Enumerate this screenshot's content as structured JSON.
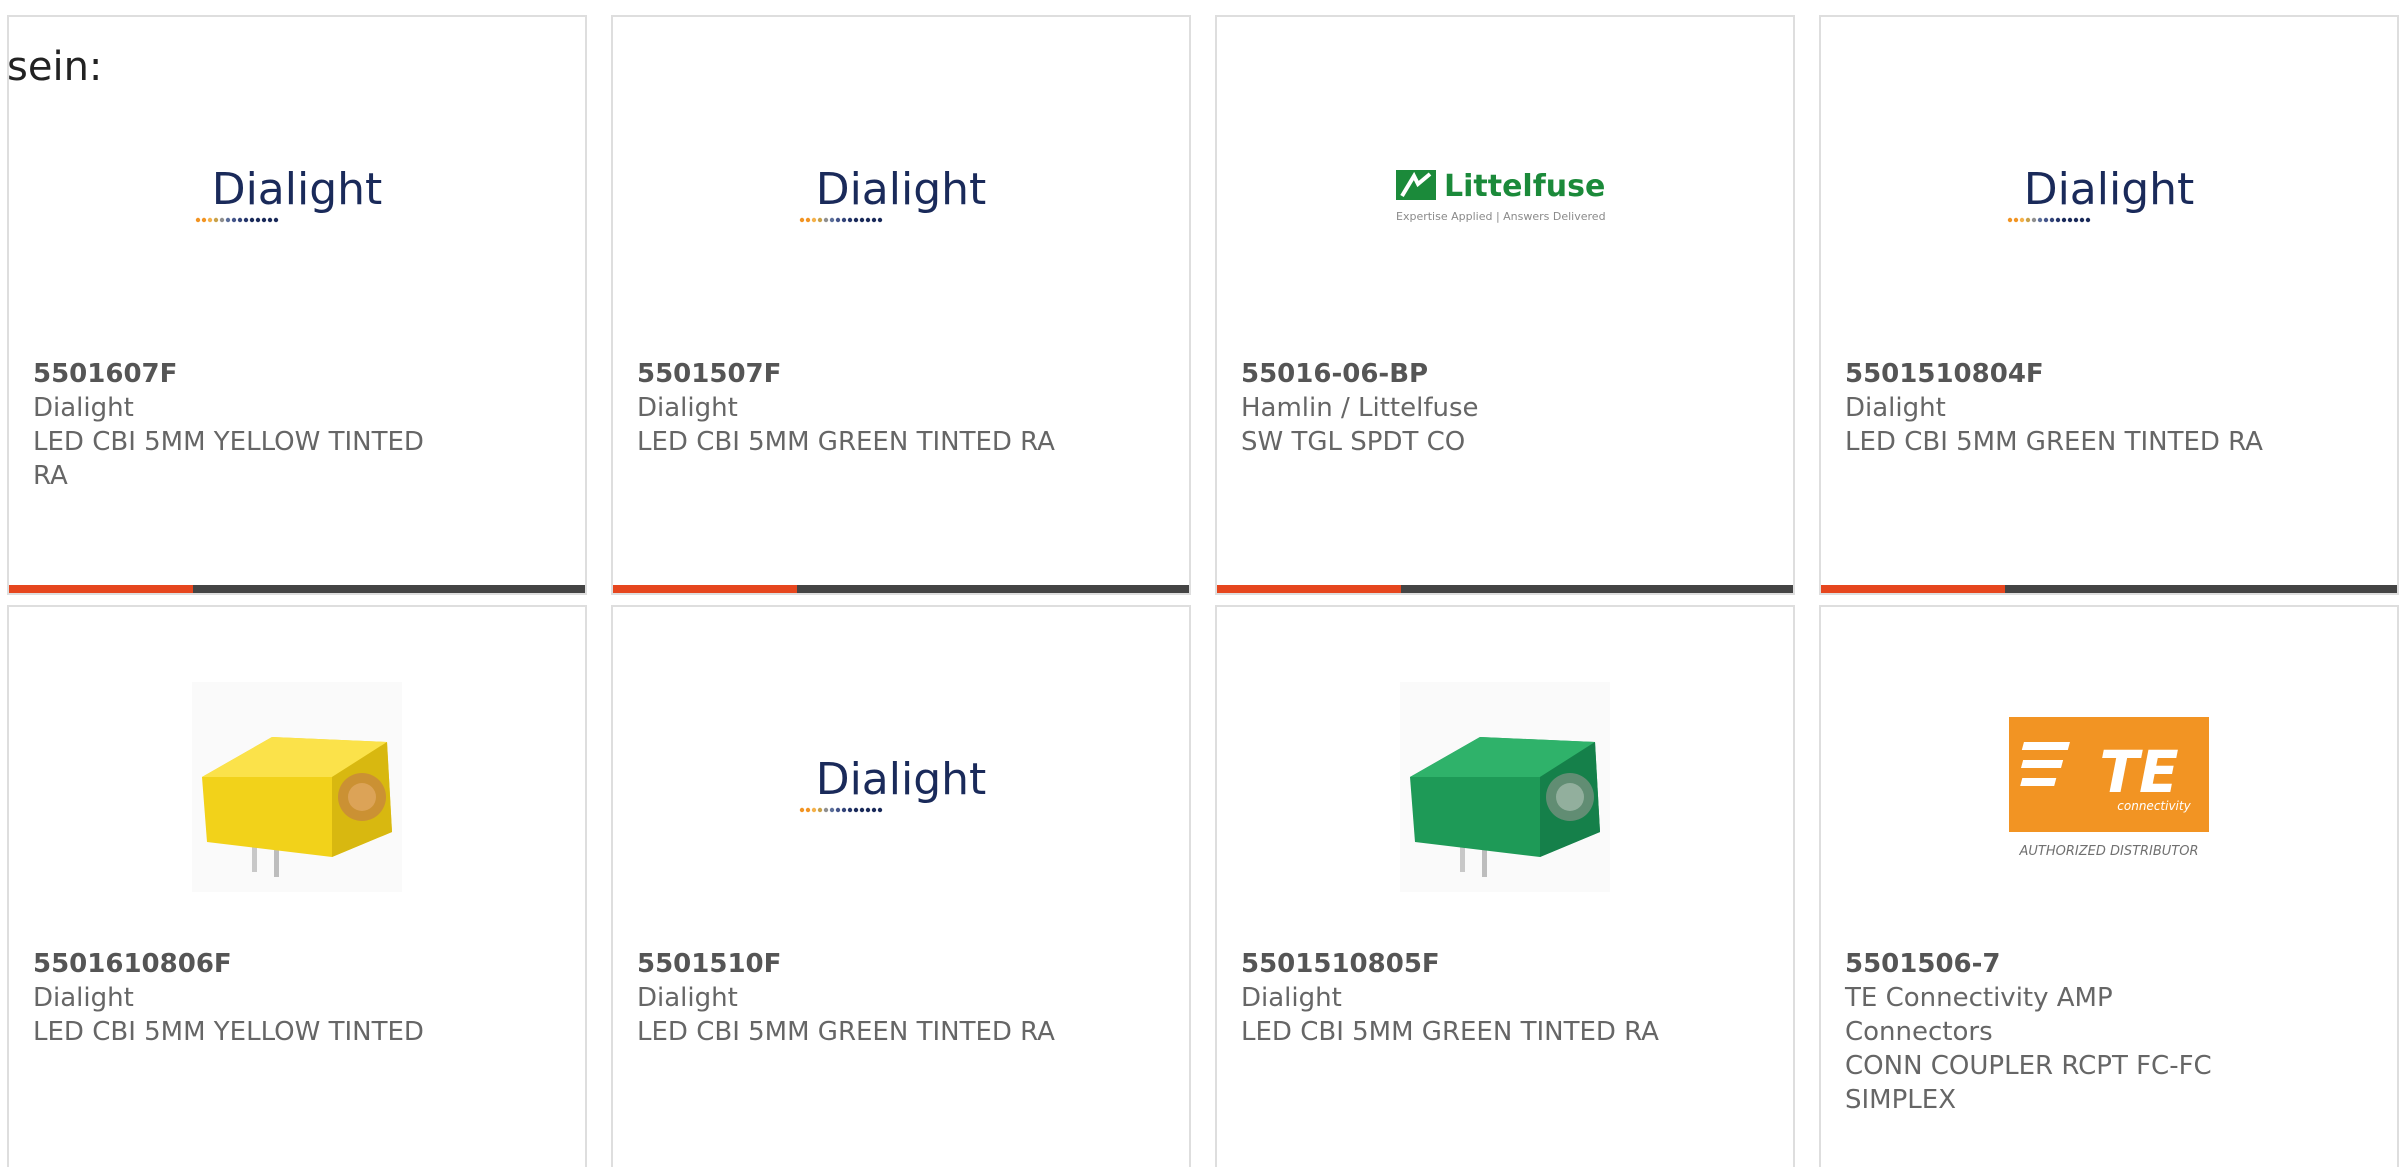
{
  "intro_text": "sein:",
  "colors": {
    "progress_fill": "#e6461e",
    "progress_track": "#444444",
    "dialight_text": "#1a2a5a",
    "littelfuse_green": "#1b8a3a",
    "te_orange": "#f29423"
  },
  "logos": {
    "dialight": {
      "name": "Dialight"
    },
    "littelfuse": {
      "name": "Littelfuse",
      "tagline": "Expertise Applied | Answers Delivered"
    },
    "te": {
      "name": "TE",
      "sub": "connectivity",
      "caption": "AUTHORIZED DISTRIBUTOR"
    }
  },
  "products": [
    {
      "part": "5501607F",
      "manufacturer": "Dialight",
      "description": "LED CBI 5MM YELLOW TINTED RA",
      "image": "dialight-logo",
      "progress": 0.32
    },
    {
      "part": "5501507F",
      "manufacturer": "Dialight",
      "description": "LED CBI 5MM GREEN TINTED RA",
      "image": "dialight-logo",
      "progress": 0.32
    },
    {
      "part": "55016-06-BP",
      "manufacturer": "Hamlin / Littelfuse",
      "description": "SW TGL SPDT CO",
      "image": "littelfuse-logo",
      "progress": 0.32
    },
    {
      "part": "5501510804F",
      "manufacturer": "Dialight",
      "description": "LED CBI 5MM GREEN TINTED RA",
      "image": "dialight-logo",
      "progress": 0.32
    },
    {
      "part": "5501610806F",
      "manufacturer": "Dialight",
      "description": "LED CBI 5MM YELLOW TINTED",
      "image": "yellow-led",
      "progress": null
    },
    {
      "part": "5501510F",
      "manufacturer": "Dialight",
      "description": "LED CBI 5MM GREEN TINTED RA",
      "image": "dialight-logo",
      "progress": null
    },
    {
      "part": "5501510805F",
      "manufacturer": "Dialight",
      "description": "LED CBI 5MM GREEN TINTED RA",
      "image": "green-led",
      "progress": null
    },
    {
      "part": "5501506-7",
      "manufacturer": "TE Connectivity AMP Connectors",
      "description": "CONN COUPLER RCPT FC-FC SIMPLEX",
      "image": "te-logo",
      "progress": null
    }
  ]
}
